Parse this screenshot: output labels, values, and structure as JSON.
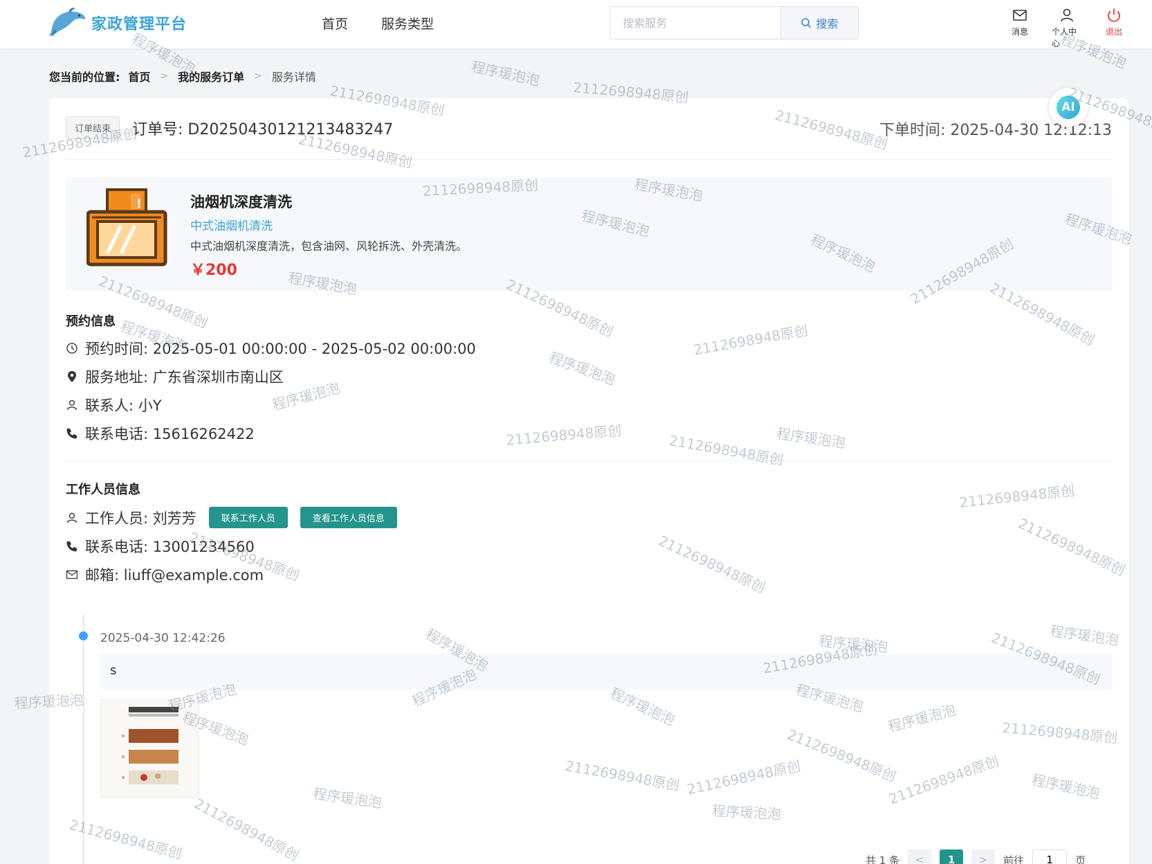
{
  "header": {
    "logo_text": "家政管理平台",
    "nav": [
      "首页",
      "服务类型"
    ],
    "search_placeholder": "搜索服务",
    "search_button": "搜索",
    "icons": [
      {
        "label": "消息",
        "icon": "mail-icon"
      },
      {
        "label": "个人中心",
        "icon": "user-icon"
      },
      {
        "label": "退出",
        "icon": "power-icon"
      }
    ]
  },
  "breadcrumb": {
    "prefix": "您当前的位置:",
    "home": "首页",
    "orders": "我的服务订单",
    "current": "服务详情"
  },
  "order": {
    "status": "订单结束",
    "number": "订单号: D20250430121213483247",
    "created": "下单时间: 2025-04-30 12:12:13"
  },
  "service": {
    "name": "油烟机深度清洗",
    "category": "中式油烟机清洗",
    "description": "中式油烟机深度清洗，包含油网、风轮拆洗、外壳清洗。",
    "price": "￥200"
  },
  "appointment": {
    "title": "预约信息",
    "time": "预约时间: 2025-05-01 00:00:00 - 2025-05-02 00:00:00",
    "address": "服务地址: 广东省深圳市南山区",
    "contact": "联系人: 小Y",
    "phone": "联系电话: 15616262422"
  },
  "worker": {
    "title": "工作人员信息",
    "name": "工作人员: 刘芳芳",
    "contact_button": "联系工作人员",
    "view_button": "查看工作人员信息",
    "phone": "联系电话: 13001234560",
    "email": "邮箱: liuff@example.com"
  },
  "timeline": [
    {
      "time": "2025-04-30 12:42:26",
      "content": "s"
    }
  ],
  "pagination": {
    "total": "共 1 条",
    "current_page": "1",
    "goto_label": "前往",
    "goto_value": "1",
    "page_unit": "页"
  },
  "ai_badge": "AI",
  "watermarks": {
    "a": "程序瑗泡泡",
    "b": "2112698948原创"
  },
  "colors": {
    "accent": "#3aa3d8",
    "teal": "#23958c",
    "price": "#e53935",
    "timeline_dot": "#409eff"
  }
}
